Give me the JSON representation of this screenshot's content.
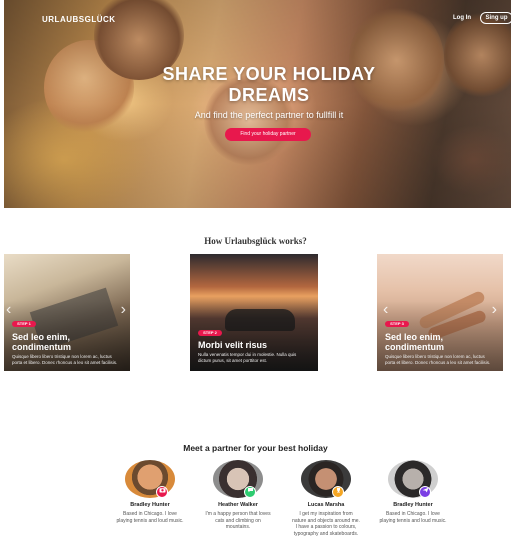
{
  "header": {
    "logo": "URLAUBSGLÜCK",
    "login_label": "Log In",
    "signup_label": "Sing up"
  },
  "hero": {
    "headline": "SHARE YOUR HOLIDAY DREAMS",
    "subheadline": "And find the perfect partner to fullfill it",
    "cta_label": "Find your holiday partner"
  },
  "how": {
    "title": "How Urlaubsglück works?",
    "steps": [
      {
        "badge": "STEP 1",
        "title": "Sed leo enim, condimentum",
        "text": "Quisque libero libero tristique non lorem ac, luctus porta et libero. Donec rhoncus a leo sit amet facilisis."
      },
      {
        "badge": "STEP 2",
        "title": "Morbi velit risus",
        "text": "Nulla venenatis tempor dui in molestie. Nulla quis dictum purus, sit amet porttitor est."
      },
      {
        "badge": "STEP 3",
        "title": "Sed leo enim, condimentum",
        "text": "Quisque libero libero tristique non lorem ac, luctus porta et libero. Donec rhoncus a leo sit amet facilisis."
      }
    ]
  },
  "partners": {
    "title": "Meet a partner for your best holiday",
    "items": [
      {
        "name": "Bradley Hunter",
        "bio": "Based in Chicago. I love playing tennis and loud music.",
        "badge_icon": "camera-icon",
        "badge_color": "#e8184d"
      },
      {
        "name": "Heather Walker",
        "bio": "I'm a happy person that loves cats and climbing on mountains.",
        "badge_icon": "chat-icon",
        "badge_color": "#2ecc71"
      },
      {
        "name": "Lucas Marsha",
        "bio": "I get my inspiration from nature and objects around me. I have a passion to colours, typography and skateboards.",
        "badge_icon": "trophy-icon",
        "badge_color": "#f5a623"
      },
      {
        "name": "Bradley Hunter",
        "bio": "Based in Chicago. I love playing tennis and loud music.",
        "badge_icon": "plane-icon",
        "badge_color": "#7b3fe4"
      }
    ]
  },
  "colors": {
    "accent": "#e8184d"
  }
}
